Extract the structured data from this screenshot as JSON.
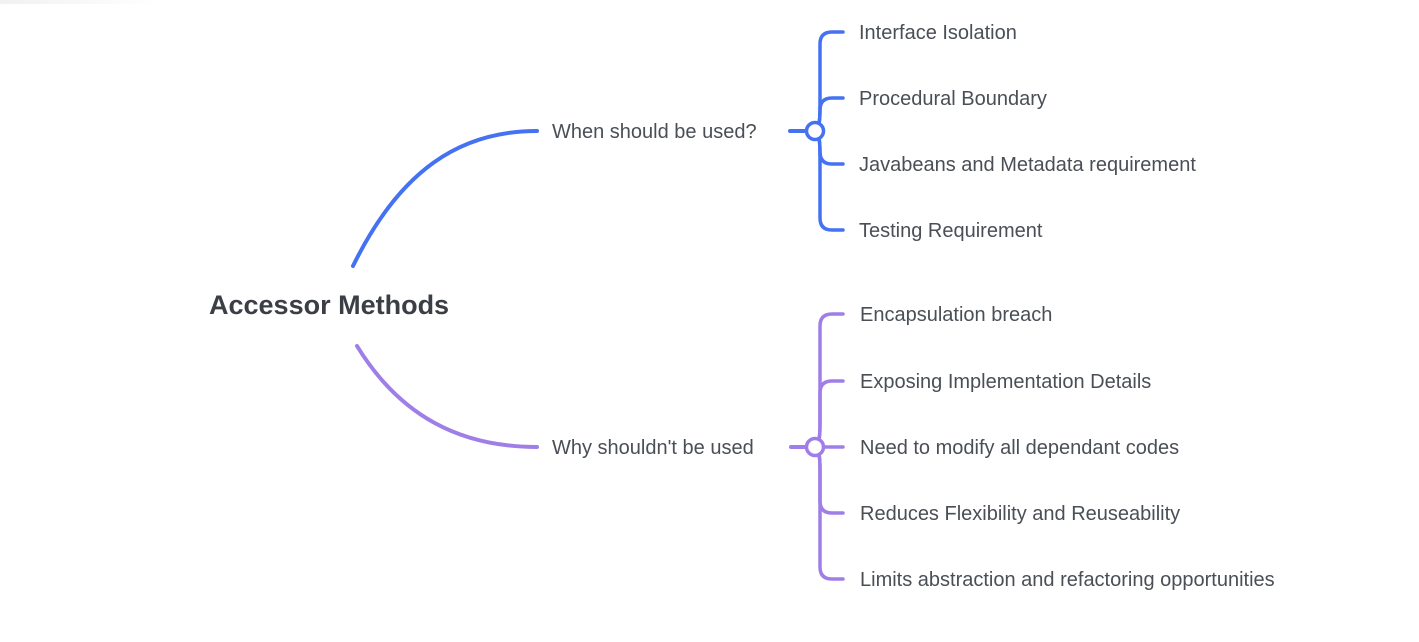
{
  "root": {
    "label": "Accessor Methods"
  },
  "branches": [
    {
      "label": "When should be used?",
      "color": "#4472f2",
      "children": [
        "Interface Isolation",
        "Procedural Boundary",
        "Javabeans and Metadata requirement",
        "Testing Requirement"
      ]
    },
    {
      "label": "Why shouldn't be used",
      "color": "#a07ee8",
      "children": [
        "Encapsulation breach",
        "Exposing Implementation Details",
        "Need to modify all dependant codes",
        "Reduces Flexibility and Reuseability",
        "Limits abstraction and refactoring opportunities"
      ]
    }
  ]
}
